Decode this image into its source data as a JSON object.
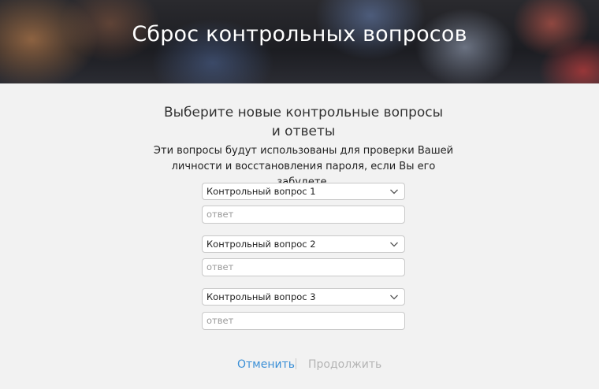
{
  "header": {
    "title": "Сброс контрольных вопросов"
  },
  "main": {
    "heading": "Выберите новые контрольные вопросы и ответы",
    "description": "Эти вопросы будут использованы для проверки Вашей личности и восстановления пароля, если Вы его забудете.",
    "questions": [
      {
        "select_value": "Контрольный вопрос 1",
        "answer_placeholder": "ответ"
      },
      {
        "select_value": "Контрольный вопрос 2",
        "answer_placeholder": "ответ"
      },
      {
        "select_value": "Контрольный вопрос 3",
        "answer_placeholder": "ответ"
      }
    ]
  },
  "footer": {
    "cancel_label": "Отменить",
    "continue_label": "Продолжить"
  },
  "colors": {
    "link": "#3a8fd6",
    "disabled": "#b4b4b4",
    "background": "#f2f2f2"
  },
  "icons": {
    "select_chevron": "chevron-down-icon"
  }
}
